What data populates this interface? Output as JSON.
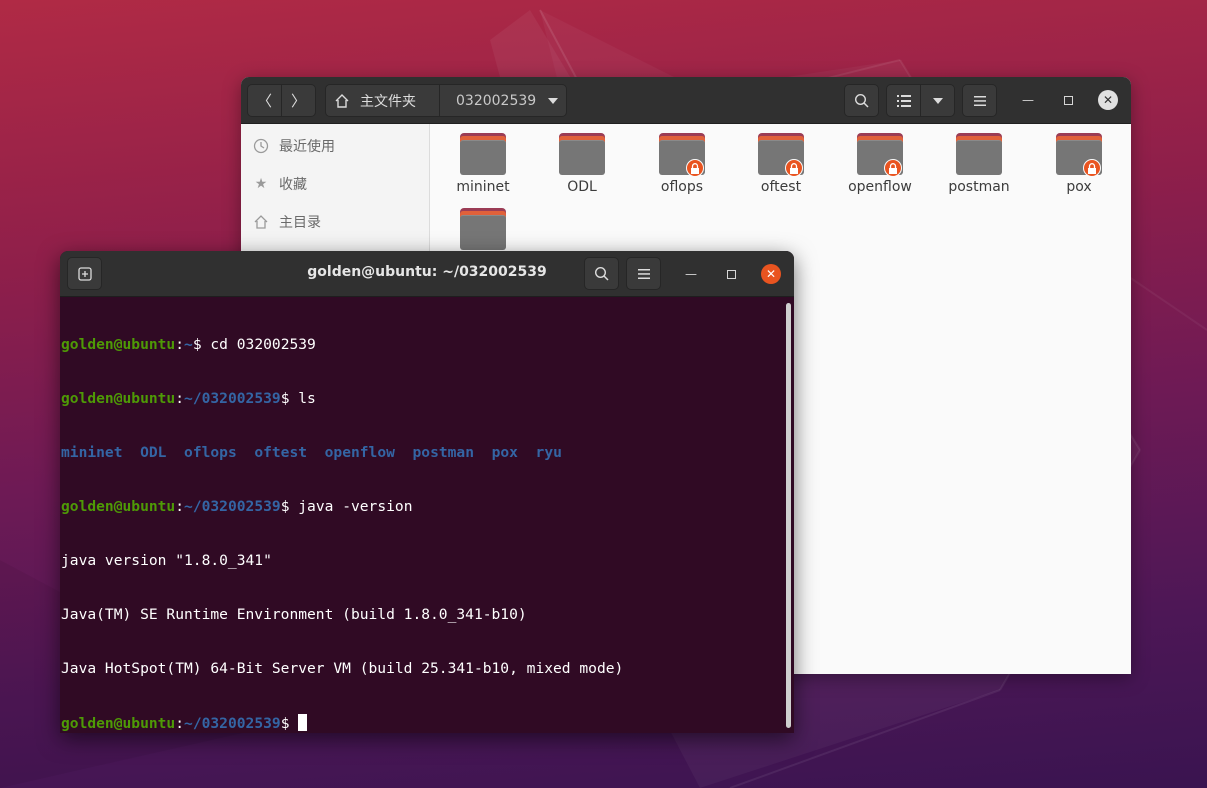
{
  "files": {
    "home_label": "主文件夹",
    "current_folder": "032002539",
    "sidebar": [
      {
        "label": "最近使用",
        "icon": "clock-icon"
      },
      {
        "label": "收藏",
        "icon": "star-icon"
      },
      {
        "label": "主目录",
        "icon": "home-icon"
      }
    ],
    "folders": [
      {
        "name": "mininet",
        "locked": false
      },
      {
        "name": "ODL",
        "locked": false
      },
      {
        "name": "oflops",
        "locked": true
      },
      {
        "name": "oftest",
        "locked": true
      },
      {
        "name": "openflow",
        "locked": true
      },
      {
        "name": "postman",
        "locked": false
      },
      {
        "name": "pox",
        "locked": true
      },
      {
        "name": "",
        "locked": false
      }
    ]
  },
  "terminal": {
    "title": "golden@ubuntu: ~/032002539",
    "user": "golden@ubuntu",
    "lines": {
      "l1_path": "~",
      "l1_cmd": "$ cd 032002539",
      "l2_path": "~/032002539",
      "l2_cmd": "$ ls",
      "ls_entries": [
        "mininet",
        "ODL",
        "oflops",
        "oftest",
        "openflow",
        "postman",
        "pox",
        "ryu"
      ],
      "l4_path": "~/032002539",
      "l4_cmd": "$ java -version",
      "out1": "java version \"1.8.0_341\"",
      "out2": "Java(TM) SE Runtime Environment (build 1.8.0_341-b10)",
      "out3": "Java HotSpot(TM) 64-Bit Server VM (build 25.341-b10, mixed mode)",
      "l8_path": "~/032002539",
      "l8_cmd": "$ "
    }
  },
  "colors": {
    "terminal_bg": "#300a24",
    "prompt_user": "#4e9a06",
    "prompt_path": "#3465a4",
    "accent": "#e95420"
  }
}
